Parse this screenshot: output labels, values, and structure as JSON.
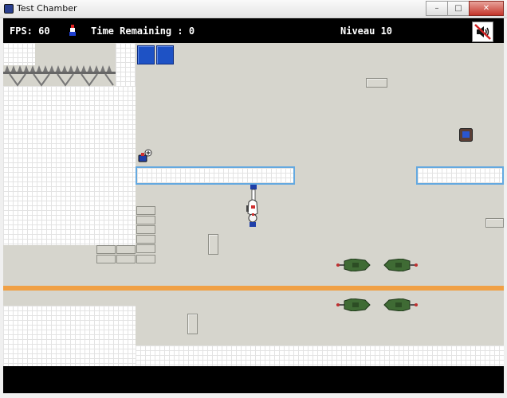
{
  "window": {
    "title": "Test Chamber",
    "controls": [
      "–",
      "□",
      "✕"
    ]
  },
  "hud": {
    "fps_label": "FPS: 60",
    "time_label": "Time Remaining : 0",
    "level_label": "Niveau 10",
    "sound_icon": "speaker-muted-icon"
  },
  "colors": {
    "floor": "#d6d5cd",
    "wall_brick": "#ffffff",
    "platform_edge": "#64a9e0",
    "laser": "#f0a045",
    "hud_bg": "#000000",
    "turret": "#3f6b34"
  }
}
